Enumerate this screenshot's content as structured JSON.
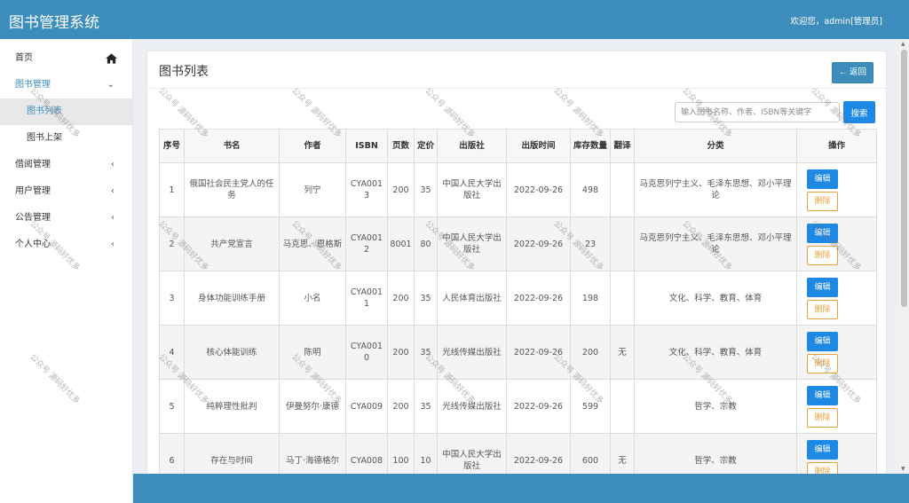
{
  "header": {
    "app_title": "图书管理系统",
    "welcome": "欢迎您，admin[管理员]"
  },
  "sidebar": {
    "items": [
      {
        "label": "首页",
        "icon": "home-icon"
      },
      {
        "label": "图书管理",
        "arrow": "⌄"
      },
      {
        "label": "图书列表"
      },
      {
        "label": "图书上架"
      },
      {
        "label": "借阅管理",
        "arrow": "‹"
      },
      {
        "label": "用户管理",
        "arrow": "‹"
      },
      {
        "label": "公告管理",
        "arrow": "‹"
      },
      {
        "label": "个人中心",
        "arrow": "‹"
      }
    ]
  },
  "main": {
    "title": "图书列表",
    "back_label": "← 返回",
    "search_placeholder": "输入图书名称、作者、ISBN等关键字",
    "search_label": "搜索",
    "columns": [
      "序号",
      "书名",
      "作者",
      "ISBN",
      "页数",
      "定价",
      "出版社",
      "出版时间",
      "库存数量",
      "翻译",
      "分类",
      "操作"
    ],
    "edit_label": "编辑",
    "delete_label": "删除",
    "rows": [
      {
        "no": "1",
        "title": "俄国社会民主党人的任务",
        "author": "列宁",
        "isbn": "CYA0013",
        "pages": "200",
        "price": "35",
        "publisher": "中国人民大学出版社",
        "date": "2022-09-26",
        "stock": "498",
        "translated": "",
        "category": "马克思列宁主义、毛泽东思想、邓小平理论"
      },
      {
        "no": "2",
        "title": "共产党宣言",
        "author": "马克思、恩格斯",
        "isbn": "CYA0012",
        "pages": "8001",
        "price": "80",
        "publisher": "中国人民大学出版社",
        "date": "2022-09-26",
        "stock": "23",
        "translated": "",
        "category": "马克思列宁主义、毛泽东思想、邓小平理论"
      },
      {
        "no": "3",
        "title": "身体功能训练手册",
        "author": "小名",
        "isbn": "CYA0011",
        "pages": "200",
        "price": "35",
        "publisher": "人民体育出版社",
        "date": "2022-09-26",
        "stock": "198",
        "translated": "",
        "category": "文化、科学、教育、体育"
      },
      {
        "no": "4",
        "title": "核心体能训练",
        "author": "陈明",
        "isbn": "CYA0010",
        "pages": "200",
        "price": "35",
        "publisher": "光线传媒出版社",
        "date": "2022-09-26",
        "stock": "200",
        "translated": "无",
        "category": "文化、科学、教育、体育"
      },
      {
        "no": "5",
        "title": "纯粹理性批判",
        "author": "伊曼努尔·康德",
        "isbn": "CYA009",
        "pages": "200",
        "price": "35",
        "publisher": "光线传媒出版社",
        "date": "2022-09-26",
        "stock": "599",
        "translated": "",
        "category": "哲学、宗教"
      },
      {
        "no": "6",
        "title": "存在与时间",
        "author": "马丁·海德格尔",
        "isbn": "CYA008",
        "pages": "100",
        "price": "10",
        "publisher": "中国人民大学出版社",
        "date": "2022-09-26",
        "stock": "600",
        "translated": "无",
        "category": "哲学、宗教"
      }
    ]
  },
  "watermark_text": "公众号 源码好优多",
  "colors": {
    "header": "#3c8dbc",
    "primary_button": "#1e88e5",
    "delete_border": "#e6a23c"
  }
}
